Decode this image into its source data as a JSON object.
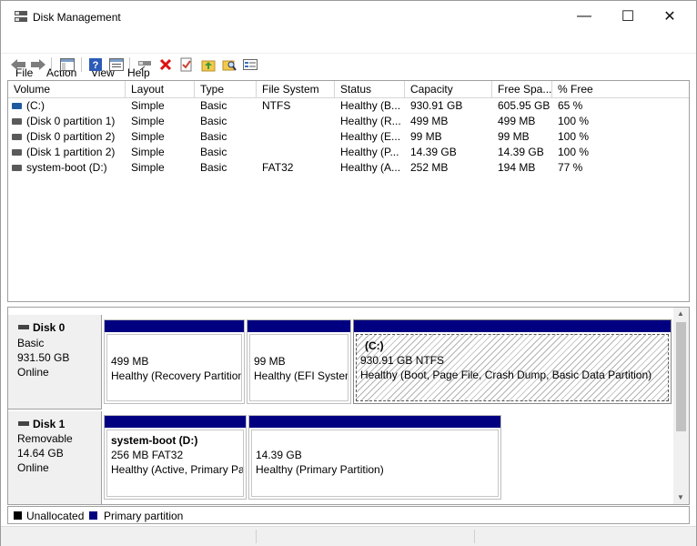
{
  "window": {
    "title": "Disk Management",
    "minimize": "—",
    "maximize": "☐",
    "close": "✕"
  },
  "menu": [
    "File",
    "Action",
    "View",
    "Help"
  ],
  "toolbar": [
    "back-arrow",
    "forward-arrow",
    "console-tree",
    "help",
    "properties",
    "connect",
    "delete",
    "check",
    "upload",
    "search",
    "settings"
  ],
  "columns": [
    "Volume",
    "Layout",
    "Type",
    "File System",
    "Status",
    "Capacity",
    "Free Spa...",
    "% Free"
  ],
  "volumes": [
    [
      "(C:)",
      "Simple",
      "Basic",
      "NTFS",
      "Healthy (B...",
      "930.91 GB",
      "605.95 GB",
      "65 %"
    ],
    [
      "(Disk 0 partition 1)",
      "Simple",
      "Basic",
      "",
      "Healthy (R...",
      "499 MB",
      "499 MB",
      "100 %"
    ],
    [
      "(Disk 0 partition 2)",
      "Simple",
      "Basic",
      "",
      "Healthy (E...",
      "99 MB",
      "99 MB",
      "100 %"
    ],
    [
      "(Disk 1 partition 2)",
      "Simple",
      "Basic",
      "",
      "Healthy (P...",
      "14.39 GB",
      "14.39 GB",
      "100 %"
    ],
    [
      "system-boot (D:)",
      "Simple",
      "Basic",
      "FAT32",
      "Healthy (A...",
      "252 MB",
      "194 MB",
      "77 %"
    ]
  ],
  "disks": [
    {
      "name": "Disk 0",
      "type": "Basic",
      "size": "931.50 GB",
      "status": "Online",
      "partitions": [
        {
          "title": "",
          "line1": "499 MB",
          "line2": "Healthy (Recovery Partition)"
        },
        {
          "title": "",
          "line1": "99 MB",
          "line2": "Healthy (EFI System Partition)"
        },
        {
          "title": "(C:)",
          "line1": "930.91 GB NTFS",
          "line2": "Healthy (Boot, Page File, Crash Dump, Basic Data Partition)"
        }
      ]
    },
    {
      "name": "Disk 1",
      "type": "Removable",
      "size": "14.64 GB",
      "status": "Online",
      "partitions": [
        {
          "title": "system-boot  (D:)",
          "line1": "256 MB FAT32",
          "line2": "Healthy (Active, Primary Partition)"
        },
        {
          "title": "",
          "line1": "14.39 GB",
          "line2": "Healthy (Primary Partition)"
        }
      ]
    }
  ],
  "legend": [
    {
      "label": "Unallocated",
      "color": "#000000"
    },
    {
      "label": "Primary partition",
      "color": "#000080"
    }
  ]
}
